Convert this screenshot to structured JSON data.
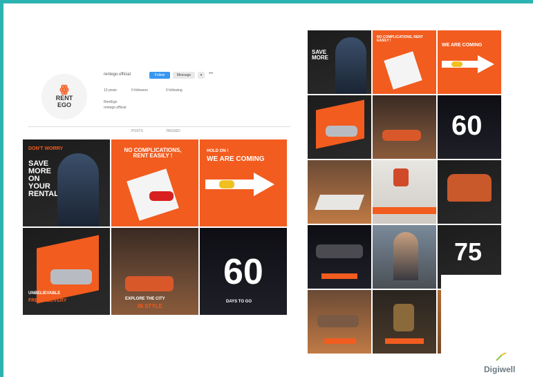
{
  "profile": {
    "avatar_logo": "RENT",
    "avatar_logo_sub": "EGO",
    "handle": "rentego.official",
    "follow_label": "Follow",
    "message_label": "Message",
    "more_label": "▾",
    "dots_label": "•••",
    "stats": [
      "13 posts",
      "0 followers",
      "0 following"
    ],
    "bio_name": "RentEgo",
    "bio_link": "rentego.official",
    "tabs": [
      "POSTS",
      "TAGGED"
    ]
  },
  "grid1": [
    {
      "title": "DON'T WORRY",
      "sub": "SAVE MORE ON YOUR RENTAL",
      "theme": "dark"
    },
    {
      "title": "NO COMPLICATIONS, RENT EASILY !",
      "theme": "orange"
    },
    {
      "title": "HOLD ON !",
      "sub": "WE ARE COMING",
      "theme": "orange"
    },
    {
      "title": "UNBELIEVABLE",
      "sub": "FREE DELIVERY",
      "theme": "dark"
    },
    {
      "title": "EXPLORE THE CITY",
      "sub": "IN STYLE",
      "theme": "city"
    },
    {
      "title": "60",
      "sub": "DAYS TO GO",
      "theme": "night"
    }
  ],
  "grid2_labels": {
    "t1": "SAVE MORE",
    "t2": "NO COMPLICATIONS, RENT EASILY !",
    "t3": "WE ARE COMING",
    "n60": "60",
    "n75": "75"
  },
  "brand": {
    "name": "Digiwell"
  }
}
